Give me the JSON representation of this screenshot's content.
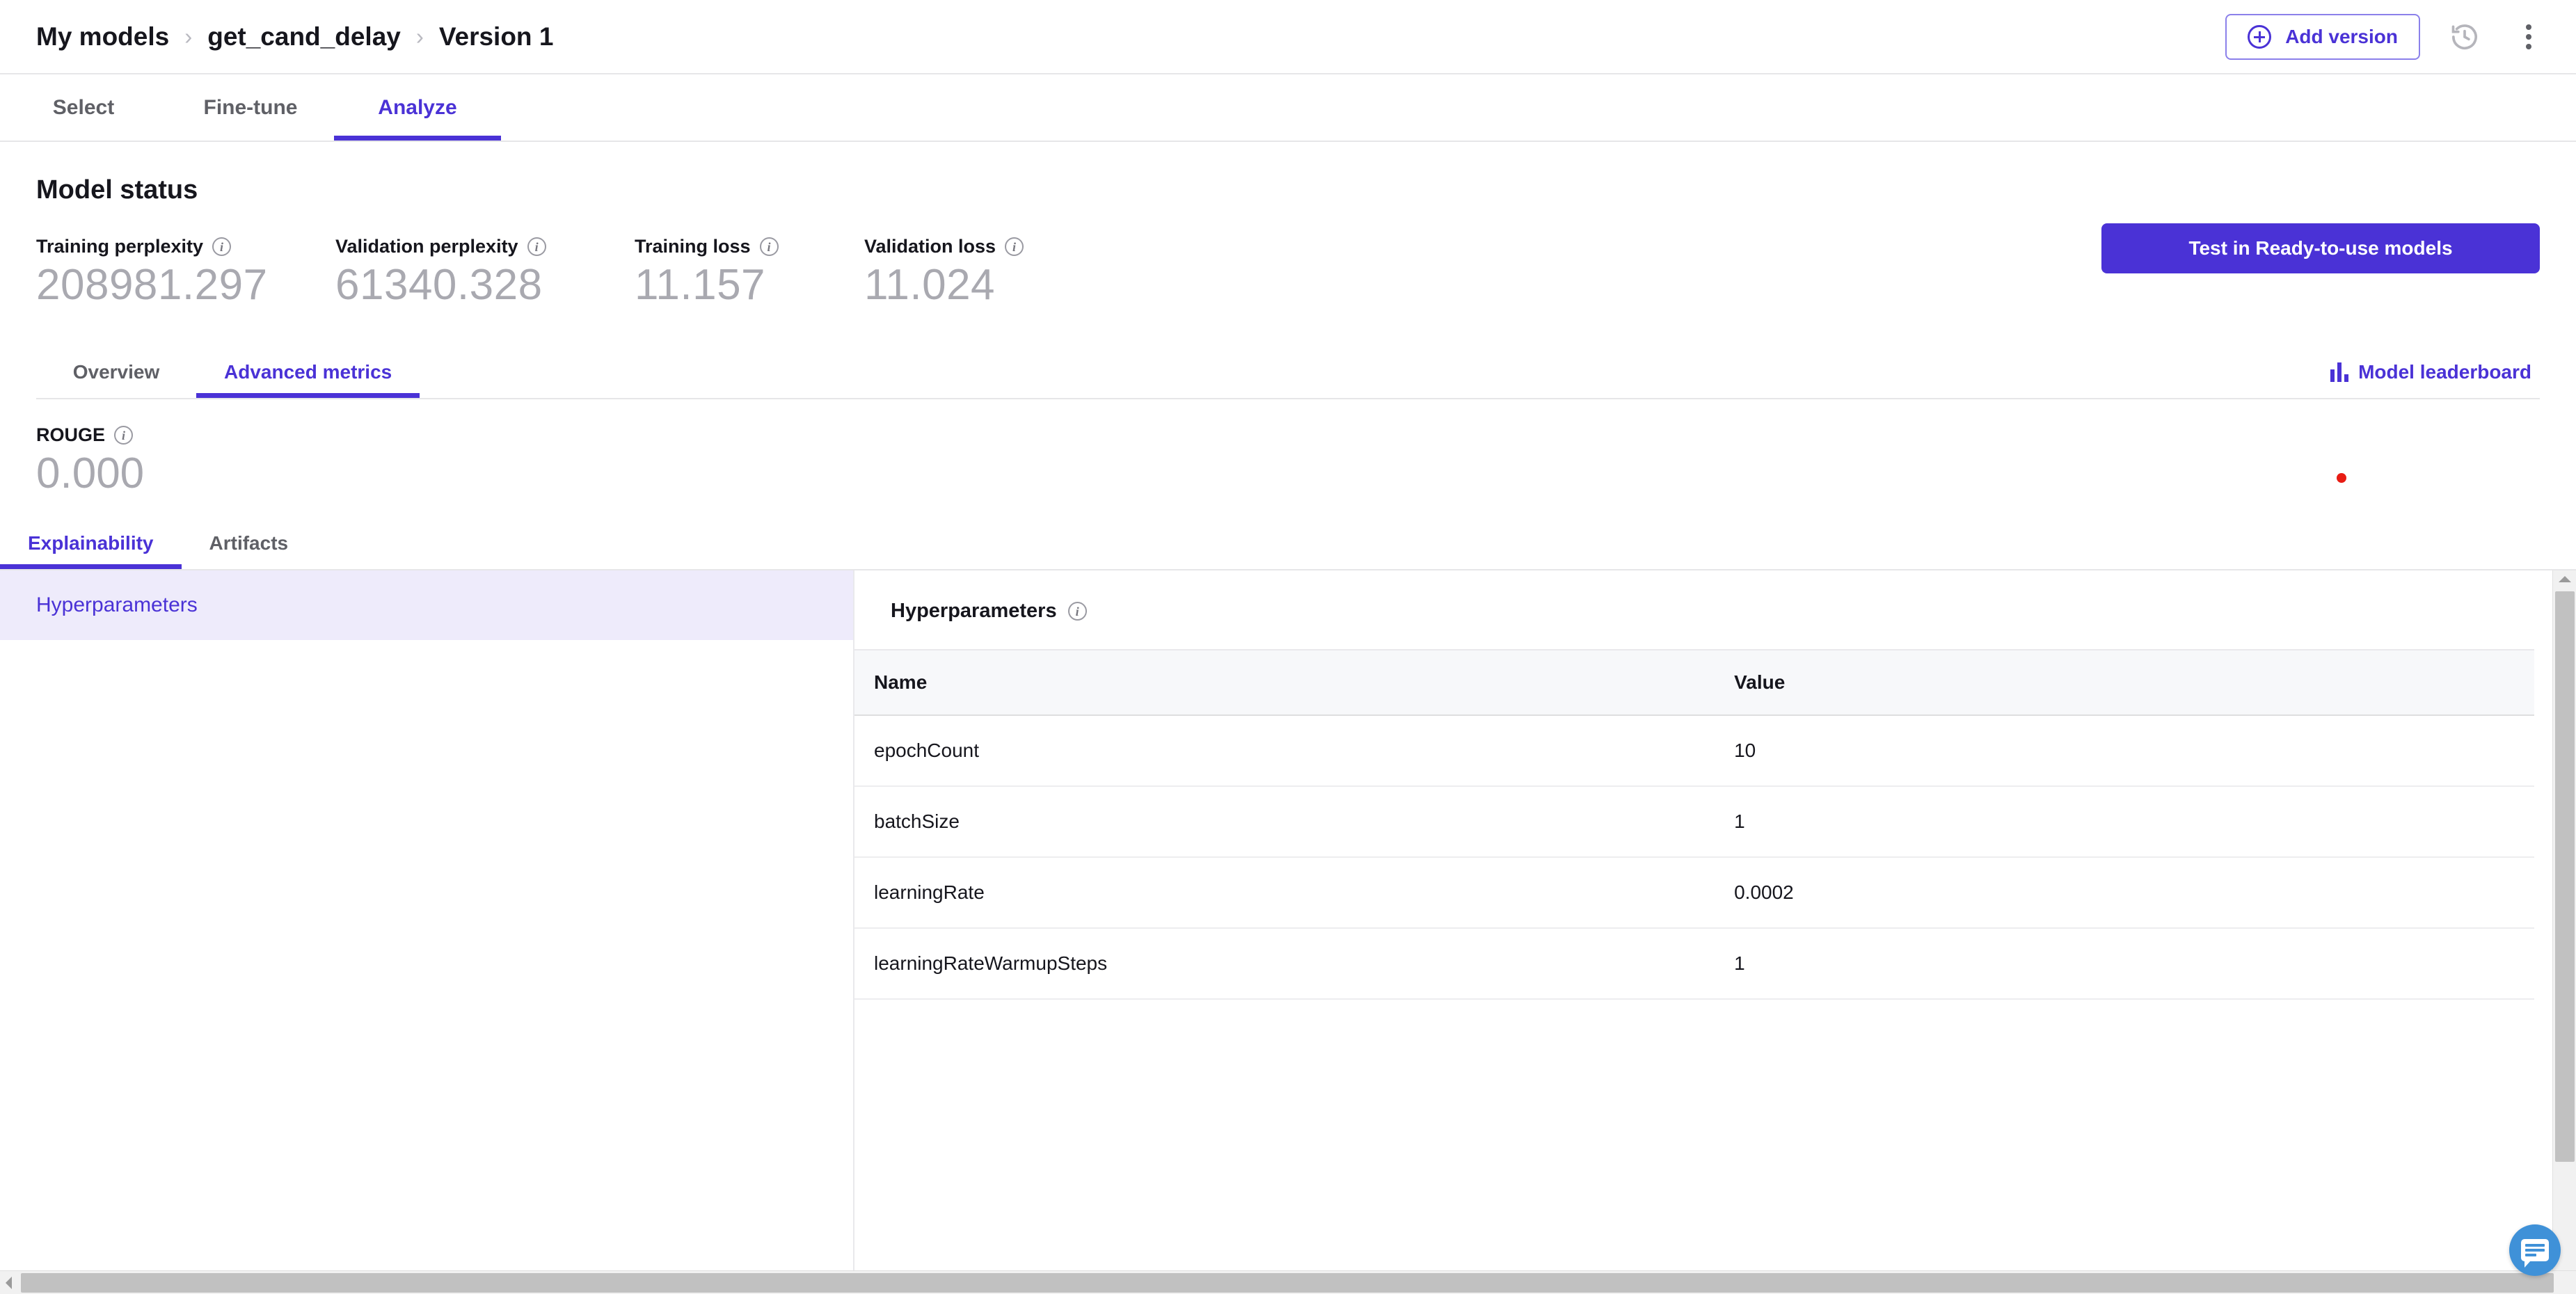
{
  "header": {
    "breadcrumb": [
      {
        "label": "My models"
      },
      {
        "label": "get_cand_delay"
      },
      {
        "label": "Version 1"
      }
    ],
    "separator": "›",
    "add_version_label": "Add version",
    "history_icon": "history-icon",
    "more_icon": "kebab-menu-icon"
  },
  "primary_tabs": [
    {
      "label": "Select",
      "active": false
    },
    {
      "label": "Fine-tune",
      "active": false
    },
    {
      "label": "Analyze",
      "active": true
    }
  ],
  "model_status": {
    "title": "Model status",
    "test_button_label": "Test in Ready-to-use models",
    "metrics": [
      {
        "label": "Training perplexity",
        "value": "208981.297"
      },
      {
        "label": "Validation perplexity",
        "value": "61340.328"
      },
      {
        "label": "Training loss",
        "value": "11.157"
      },
      {
        "label": "Validation loss",
        "value": "11.024"
      }
    ]
  },
  "secondary_tabs": [
    {
      "label": "Overview",
      "active": false
    },
    {
      "label": "Advanced metrics",
      "active": true
    }
  ],
  "leaderboard": {
    "label": "Model leaderboard"
  },
  "rouge": {
    "label": "ROUGE",
    "value": "0.000"
  },
  "tertiary_tabs": [
    {
      "label": "Explainability",
      "active": true
    },
    {
      "label": "Artifacts",
      "active": false
    }
  ],
  "sidebar": {
    "items": [
      {
        "label": "Hyperparameters",
        "selected": true
      }
    ]
  },
  "panel": {
    "title": "Hyperparameters",
    "columns": [
      "Name",
      "Value"
    ],
    "rows": [
      {
        "name": "epochCount",
        "value": "10"
      },
      {
        "name": "batchSize",
        "value": "1"
      },
      {
        "name": "learningRate",
        "value": "0.0002"
      },
      {
        "name": "learningRateWarmupSteps",
        "value": "1"
      }
    ]
  },
  "colors": {
    "accent": "#4a32d6",
    "accent_soft": "#eeebfb",
    "muted_value": "#a9a9b0",
    "chat": "#3f91d8",
    "cursor_dot": "#e81c14"
  }
}
